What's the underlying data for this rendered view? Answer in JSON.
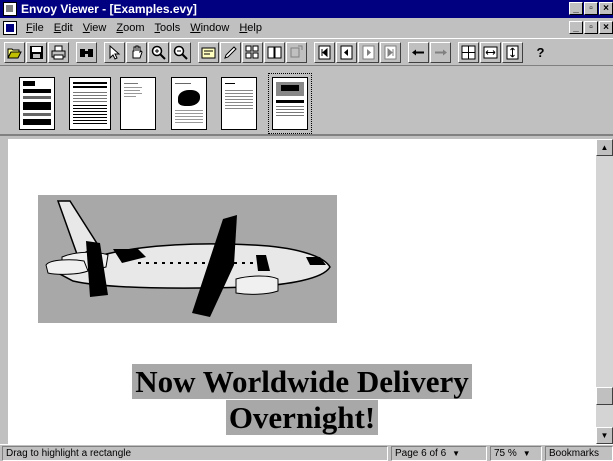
{
  "window": {
    "title": "Envoy Viewer - [Examples.evy]"
  },
  "menu": {
    "items": [
      {
        "u": "F",
        "rest": "ile"
      },
      {
        "u": "E",
        "rest": "dit"
      },
      {
        "u": "V",
        "rest": "iew"
      },
      {
        "u": "Z",
        "rest": "oom"
      },
      {
        "u": "T",
        "rest": "ools"
      },
      {
        "u": "W",
        "rest": "indow"
      },
      {
        "u": "H",
        "rest": "elp"
      }
    ]
  },
  "toolbar": {
    "icons": [
      "open-icon",
      "save-icon",
      "print-icon",
      "find-icon",
      "select-arrow-icon",
      "hand-icon",
      "zoom-in-icon",
      "zoom-out-icon",
      "note-icon",
      "highlighter-icon",
      "thumbnails-icon",
      "bookmarks-icon",
      "link-icon",
      "first-page-icon",
      "previous-page-icon",
      "next-page-icon",
      "last-page-icon",
      "back-icon",
      "forward-icon",
      "fit-page-icon",
      "fit-width-icon",
      "fit-height-icon",
      "help-icon"
    ]
  },
  "document": {
    "headline_line1": "Now Worldwide Delivery",
    "headline_line2": "Overnight!"
  },
  "status": {
    "hint": "Drag to highlight a rectangle",
    "page": "Page 6 of 6",
    "zoom": "75 %",
    "bookmarks": "Bookmarks"
  },
  "colors": {
    "titlebar": "#000080",
    "highlight": "#a8a8a8"
  }
}
